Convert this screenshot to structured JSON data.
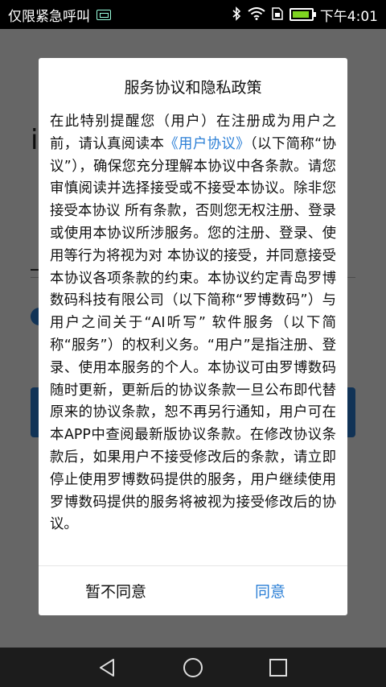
{
  "status_bar": {
    "carrier": "仅限紧急呼叫",
    "time": "下午4:01"
  },
  "dialog": {
    "title": "服务协议和隐私政策",
    "body_before_link": "在此特别提醒您（用户）在注册成为用户之前，请认真阅读本",
    "link_text": "《用户协议》",
    "body_after_link": "（以下简称“协议”），确保您充分理解本协议中各条款。请您审慎阅读并选择接受或不接受本协议。除非您接受本协议 所有条款，否则您无权注册、登录或使用本协议所涉服务。您的注册、登录、使用等行为将视为对 本协议的接受，并同意接受本协议各项条款的约束。本协议约定青岛罗博数码科技有限公司（以下简称“罗博数码”）与用户之间关于“AI听写” 软件服务（以下简称“服务”）的权利义务。“用户”是指注册、登录、使用本服务的个人。本协议可由罗博数码随时更新，更新后的协议条款一旦公布即代替原来的协议条款，恕不再另行通知，用户可在本APP中查阅最新版协议条款。在修改协议条款后，如果用户不接受修改后的条款，请立即停止使用罗博数码提供的服务，用户继续使用罗博数码提供的服务将被视为接受修改后的协议。",
    "decline_label": "暂不同意",
    "accept_label": "同意"
  },
  "colors": {
    "accent": "#2b7fd6",
    "battery": "#7ed321"
  },
  "icons": [
    "sim-icon",
    "bluetooth-icon",
    "wifi-icon",
    "sim-card-icon",
    "battery-icon",
    "back-icon",
    "home-icon",
    "recents-icon"
  ]
}
